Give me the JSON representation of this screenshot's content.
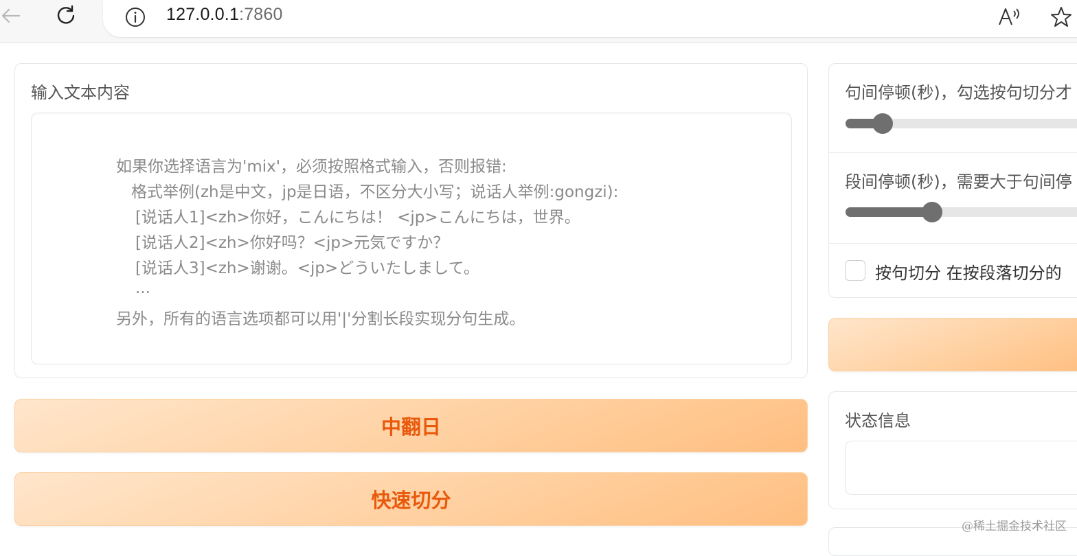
{
  "browser": {
    "url_host": "127.0.0.1",
    "url_port": ":7860",
    "icons": [
      "back-icon",
      "reload-icon",
      "info-icon",
      "read-aloud-icon",
      "favorite-star-icon"
    ]
  },
  "input_card": {
    "label": "输入文本内容",
    "placeholder_lines": [
      "如果你选择语言为'mix'，必须按照格式输入，否则报错:",
      "格式举例(zh是中文，jp是日语，不区分大小写；说话人举例:gongzi):",
      "[说话人1]<zh>你好，こんにちは！ <jp>こんにちは，世界。",
      "[说话人2]<zh>你好吗？<jp>元気ですか？",
      "[说话人3]<zh>谢谢。<jp>どういたしまして。",
      "...",
      "另外，所有的语言选项都可以用'|'分割长段实现分句生成。"
    ]
  },
  "buttons": {
    "translate": "中翻日",
    "quick_split": "快速切分"
  },
  "settings_card": {
    "sentence_pause_label": "句间停顿(秒)，勾选按句切分才",
    "sentence_pause_level": 0.15,
    "paragraph_pause_label": "段间停顿(秒)，需要大于句间停",
    "paragraph_pause_level": 0.35,
    "split_checkbox_label": "按句切分 在按段落切分的",
    "split_checked": false
  },
  "status_card": {
    "label": "状态信息",
    "value": ""
  },
  "watermark": "@稀土掘金技术社区"
}
